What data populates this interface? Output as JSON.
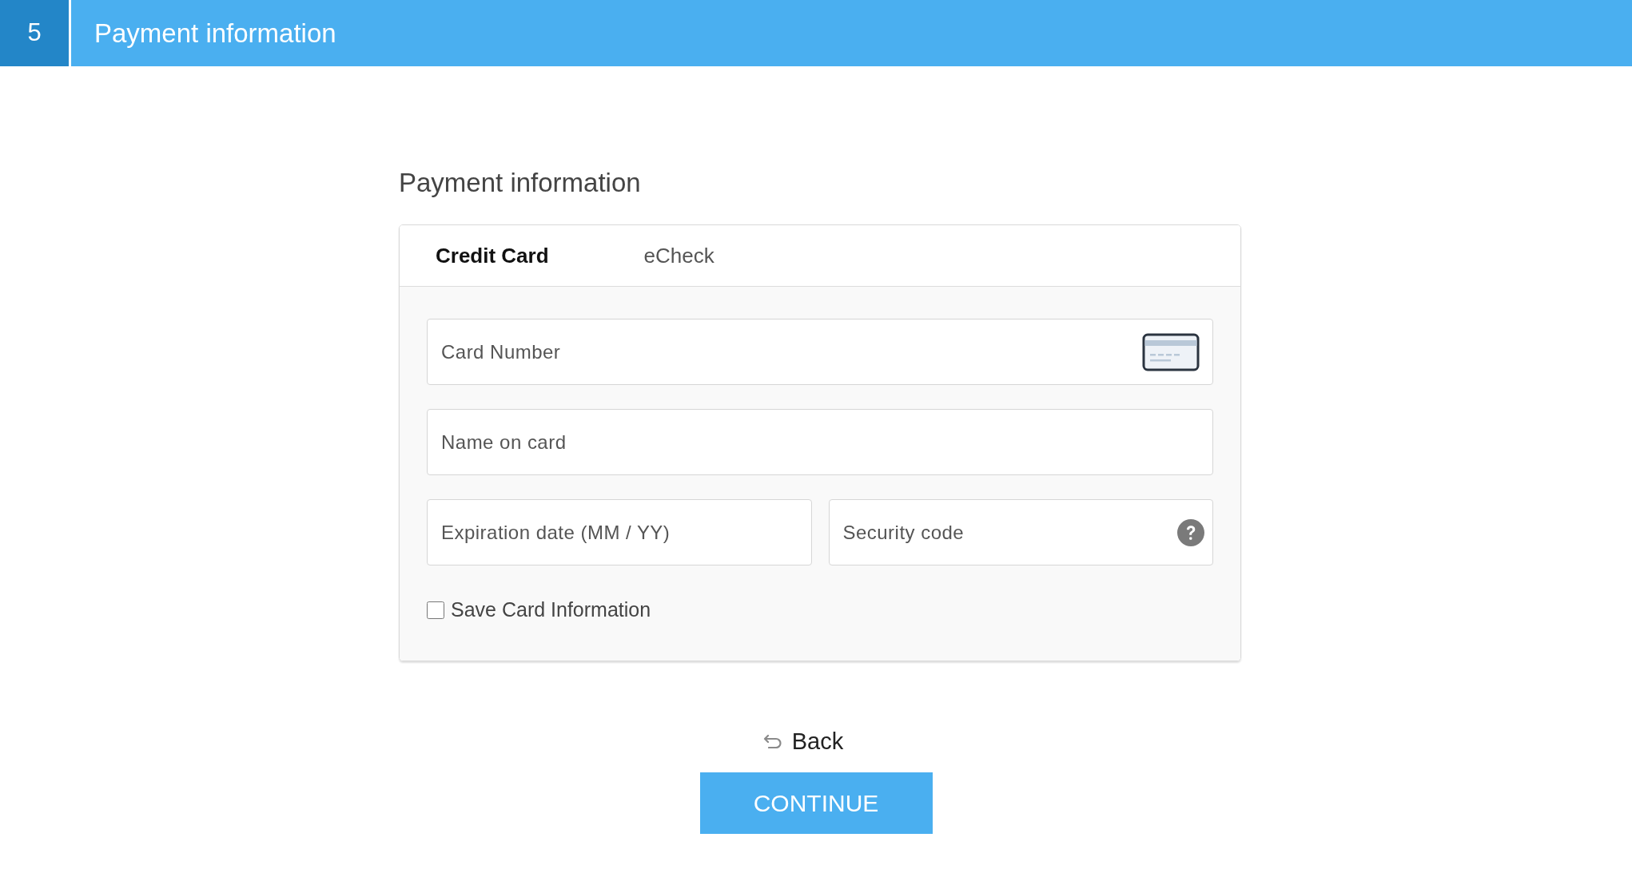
{
  "header": {
    "step": "5",
    "title": "Payment information"
  },
  "section_title": "Payment information",
  "tabs": [
    {
      "label": "Credit Card",
      "selected": true
    },
    {
      "label": "eCheck",
      "selected": false
    }
  ],
  "rows": [
    {
      "fields": [
        {
          "kind": "card_number",
          "placeholder": "Card Number"
        }
      ]
    },
    {
      "fields": [
        {
          "kind": "text",
          "placeholder": "Name on card"
        }
      ]
    },
    {
      "fields": [
        {
          "kind": "text",
          "placeholder": "Expiration date (MM / YY)"
        },
        {
          "kind": "security_code",
          "placeholder": "Security code"
        }
      ]
    }
  ],
  "save_card": {
    "label": "Save Card Information",
    "checked": false
  },
  "back": {
    "label": "Back"
  },
  "continue": {
    "label": "CONTINUE"
  }
}
